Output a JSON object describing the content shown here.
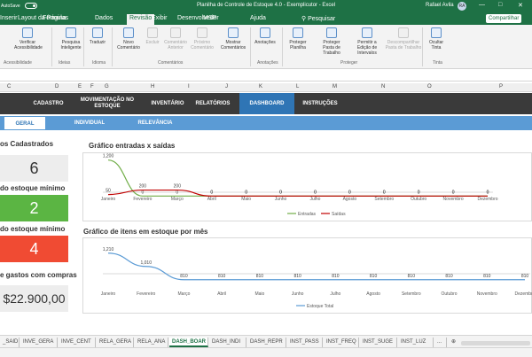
{
  "window": {
    "autosave_label": "AutoSave",
    "title": "Planilha de Controle de Estoque 4.0 - Exemplicutor  -  Excel",
    "user_name": "Rafael Avila",
    "user_initials": "RA"
  },
  "menu": {
    "tabs": [
      "Arquivo",
      "Página Inicial",
      "Inserir",
      "Layout da Página",
      "Fórmulas",
      "Dados",
      "Revisão",
      "Exibir",
      "Desenvolvedor",
      "MSP",
      "Ajuda"
    ],
    "visible_tabs": [
      "Inserir",
      "Layout da Página",
      "Fórmulas",
      "Dados",
      "Revisão",
      "Exibir",
      "Desenvolvedor",
      "MSP",
      "Ajuda"
    ],
    "active_tab": "Revisão",
    "search_label": "Pesquisar",
    "share_label": "Compartilhar"
  },
  "ribbon": {
    "buttons": [
      {
        "label": "Verificar Acessibilidade",
        "disabled": false
      },
      {
        "label": "Pesquisa Inteligente",
        "disabled": false
      },
      {
        "label": "Traduzir",
        "disabled": false
      },
      {
        "label": "Novo Comentário",
        "disabled": false
      },
      {
        "label": "Excluir",
        "disabled": true
      },
      {
        "label": "Comentário Anterior",
        "disabled": true
      },
      {
        "label": "Próximo Comentário",
        "disabled": true
      },
      {
        "label": "Mostrar Comentários",
        "disabled": false
      },
      {
        "label": "Anotações",
        "disabled": false
      },
      {
        "label": "Proteger Planilha",
        "disabled": false
      },
      {
        "label": "Proteger Pasta de Trabalho",
        "disabled": false
      },
      {
        "label": "Permitir a Edição de Intervalos",
        "disabled": false
      },
      {
        "label": "Descompartilhar Pasta de Trabalho",
        "disabled": true
      },
      {
        "label": "Ocultar Tinta",
        "disabled": false
      }
    ],
    "groups": [
      "Acessibilidade",
      "Ideias",
      "Idioma",
      "Comentários",
      "Anotações",
      "Proteger",
      "Tinta"
    ]
  },
  "columns": [
    "C",
    "D",
    "E",
    "F",
    "G",
    "H",
    "I",
    "J",
    "K",
    "L",
    "M",
    "N",
    "O",
    "P"
  ],
  "dashboard_nav": {
    "items": [
      "CADASTRO",
      "MOVIMENTAÇÃO NO ESTOQUE",
      "INVENTÁRIO",
      "RELATÓRIOS",
      "DASHBOARD",
      "INSTRUÇÕES"
    ],
    "active": "DASHBOARD"
  },
  "sub_nav": {
    "items": [
      "GERAL",
      "INDIVIDUAL",
      "RELEVÂNCIA"
    ],
    "active": "GERAL"
  },
  "kpis": [
    {
      "title": "os Cadastrados",
      "value": "6",
      "bg": "#ededed",
      "fg": "#333333"
    },
    {
      "title": "do estoque mínimo",
      "value": "2",
      "bg": "#5bb543",
      "fg": "#ffffff"
    },
    {
      "title": "do estoque mínimo",
      "value": "4",
      "bg": "#f04b33",
      "fg": "#ffffff"
    },
    {
      "title": "e gastos com compras",
      "value": "$22.900,00",
      "bg": "#ededed",
      "fg": "#333333"
    }
  ],
  "charts": {
    "movement_title": "Gráfico entradas x saídas",
    "stock_title": "Gráfico de itens em estoque por mês"
  },
  "chart_data": [
    {
      "type": "line",
      "title": "Gráfico entradas x saídas",
      "categories": [
        "Janeiro",
        "Fevereiro",
        "Março",
        "Abril",
        "Maio",
        "Junho",
        "Julho",
        "Agosto",
        "Setembro",
        "Outubro",
        "Novembro",
        "Dezembro"
      ],
      "series": [
        {
          "name": "Entradas",
          "color": "#70ad47",
          "values": [
            1200,
            0,
            0,
            0,
            0,
            0,
            0,
            0,
            0,
            0,
            0,
            0
          ]
        },
        {
          "name": "Saídas",
          "color": "#c00000",
          "values": [
            50,
            200,
            200,
            0,
            0,
            0,
            0,
            0,
            0,
            0,
            0,
            0
          ]
        }
      ],
      "ylim": [
        -50,
        1250
      ],
      "legend": "bottom"
    },
    {
      "type": "line",
      "title": "Gráfico de itens em estoque por mês",
      "categories": [
        "Janeiro",
        "Fevereiro",
        "Março",
        "Abril",
        "Maio",
        "Junho",
        "Julho",
        "Agosto",
        "Setembro",
        "Outubro",
        "Novembro",
        "Dezembro"
      ],
      "series": [
        {
          "name": "Estoque Total",
          "color": "#5b9bd5",
          "values": [
            1210,
            1010,
            810,
            810,
            810,
            810,
            810,
            810,
            810,
            810,
            810,
            810
          ]
        }
      ],
      "ylim": [
        700,
        1300
      ],
      "legend": "bottom"
    }
  ],
  "sheet_tabs": [
    "_SAID",
    "INVE_GERA",
    "INVE_CENT",
    "RELA_GERA",
    "RELA_ANA",
    "DASH_BOAR",
    "DASH_INDI",
    "DASH_REPR",
    "INST_PASS",
    "INST_FREQ",
    "INST_SUGE",
    "INST_LUZ"
  ],
  "active_sheet": "DASH_BOAR"
}
